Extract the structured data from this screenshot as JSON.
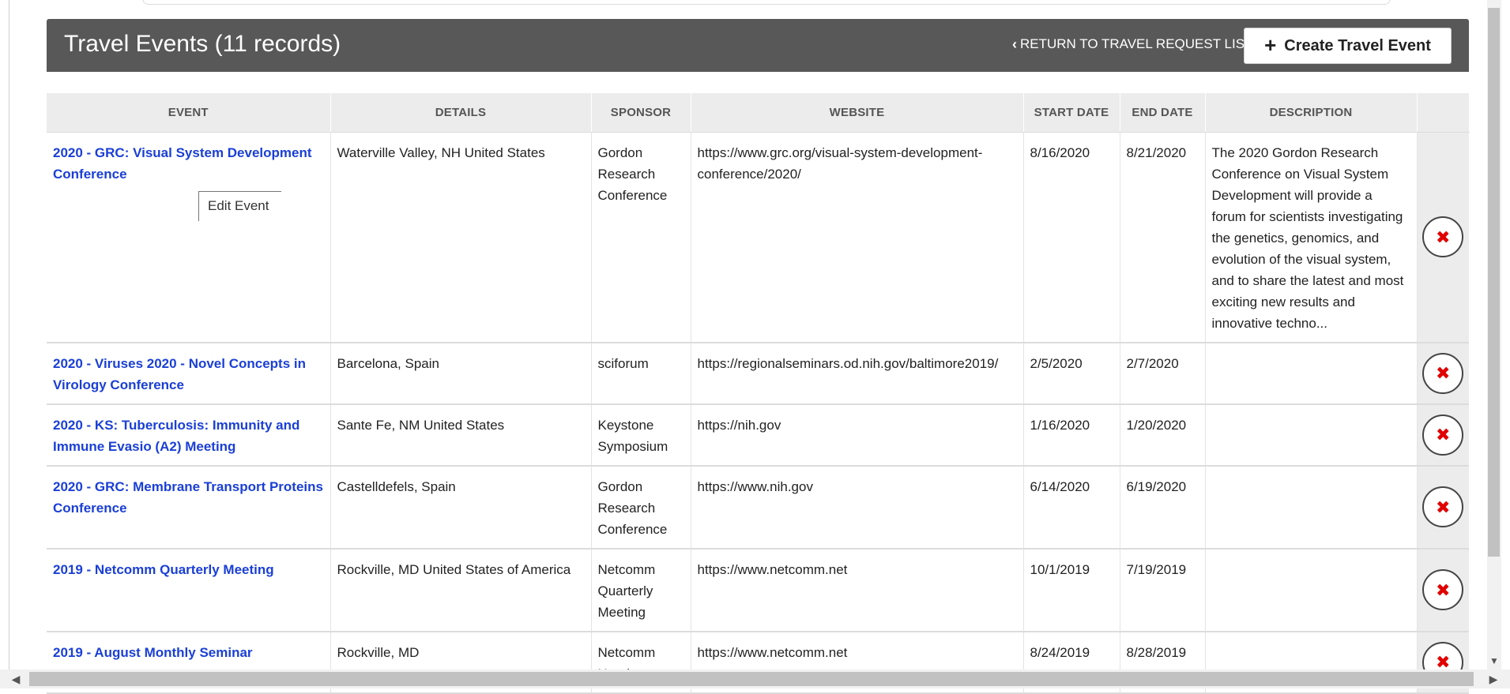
{
  "header": {
    "title": "Travel Events (11 records)",
    "return_label": "RETURN TO TRAVEL REQUEST LIST",
    "create_label": "Create Travel Event"
  },
  "table": {
    "columns": [
      "EVENT",
      "DETAILS",
      "SPONSOR",
      "WEBSITE",
      "START DATE",
      "END DATE",
      "DESCRIPTION"
    ],
    "rows": [
      {
        "event": "2020 - GRC: Visual System Development Conference",
        "details": "Waterville Valley, NH United States",
        "sponsor": "Gordon Research Conference",
        "website": "https://www.grc.org/visual-system-development-conference/2020/",
        "start": "8/16/2020",
        "end": "8/21/2020",
        "description": "The 2020 Gordon Research Conference on Visual System Development will provide a forum for scientists investigating the genetics, genomics, and evolution of the visual system, and to share the latest and most exciting new results and innovative techno..."
      },
      {
        "event": "2020 - Viruses 2020 - Novel Concepts in Virology Conference",
        "details": "Barcelona, Spain",
        "sponsor": "sciforum",
        "website": "https://regionalseminars.od.nih.gov/baltimore2019/",
        "start": "2/5/2020",
        "end": "2/7/2020",
        "description": ""
      },
      {
        "event": "2020 - KS: Tuberculosis: Immunity and Immune Evasio (A2) Meeting",
        "details": "Sante Fe, NM United States",
        "sponsor": "Keystone Symposium",
        "website": "https://nih.gov",
        "start": "1/16/2020",
        "end": "1/20/2020",
        "description": ""
      },
      {
        "event": "2020 - GRC: Membrane Transport Proteins Conference",
        "details": "Castelldefels, Spain",
        "sponsor": "Gordon Research Conference",
        "website": "https://www.nih.gov",
        "start": "6/14/2020",
        "end": "6/19/2020",
        "description": ""
      },
      {
        "event": "2019 - Netcomm Quarterly Meeting",
        "details": "Rockville, MD United States of America",
        "sponsor": "Netcomm Quarterly Meeting",
        "website": "https://www.netcomm.net",
        "start": "10/1/2019",
        "end": "7/19/2019",
        "description": ""
      },
      {
        "event": "2019 - August Monthly Seminar",
        "details": "Rockville, MD",
        "sponsor": "Netcomm Headquarters",
        "website": "https://www.netcomm.net",
        "start": "8/24/2019",
        "end": "8/28/2019",
        "description": ""
      }
    ]
  },
  "tooltip": {
    "text": "Edit Event"
  },
  "icons": {
    "chevron": "chevron-left-icon",
    "plus": "plus-icon",
    "delete": "delete-x-icon"
  },
  "colors": {
    "header_bg": "#585858",
    "link": "#1a3fd6",
    "delete": "#e00000"
  }
}
